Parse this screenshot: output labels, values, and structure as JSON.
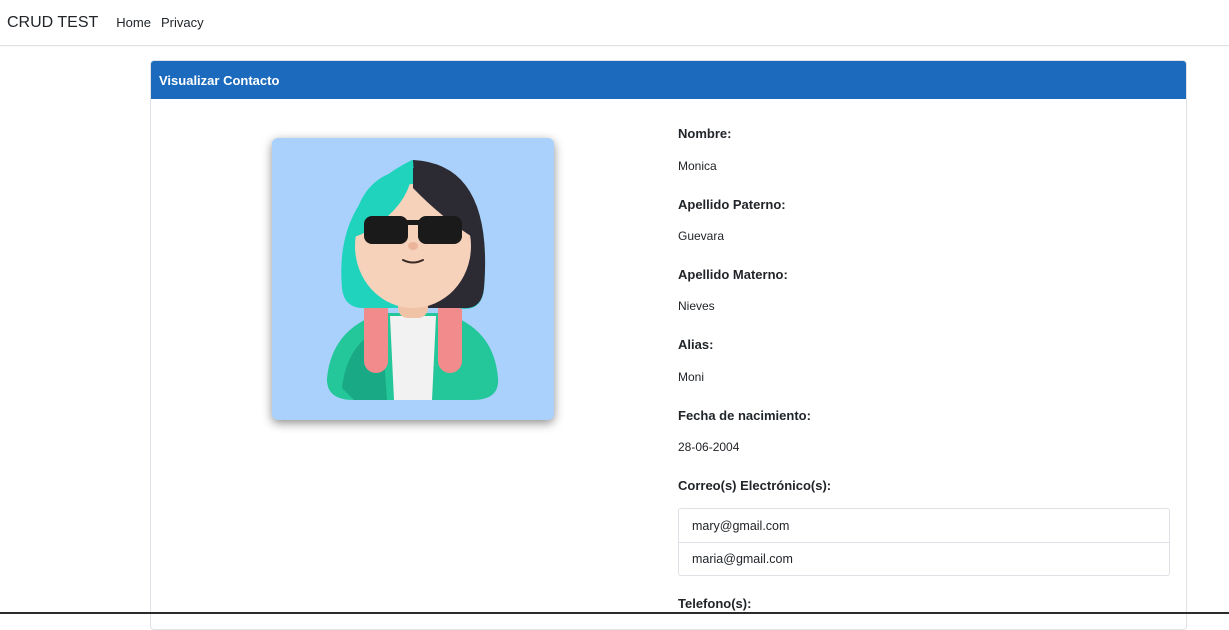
{
  "navbar": {
    "brand": "CRUD TEST",
    "links": [
      "Home",
      "Privacy"
    ]
  },
  "card": {
    "title": "Visualizar Contacto",
    "header_color": "#1c6abd"
  },
  "contact": {
    "nombre_label": "Nombre:",
    "nombre": "Monica",
    "apellido_paterno_label": "Apellido Paterno:",
    "apellido_paterno": "Guevara",
    "apellido_materno_label": "Apellido Materno:",
    "apellido_materno": "Nieves",
    "alias_label": "Alias:",
    "alias": "Moni",
    "fecha_label": "Fecha de nacimiento:",
    "fecha": "28-06-2004",
    "correos_label": "Correo(s) Electrónico(s):",
    "correos": [
      "mary@gmail.com",
      "maria@gmail.com"
    ],
    "telefonos_label": "Telefono(s):"
  },
  "avatar": {
    "icon": "avatar-3d-girl-sunglasses"
  }
}
